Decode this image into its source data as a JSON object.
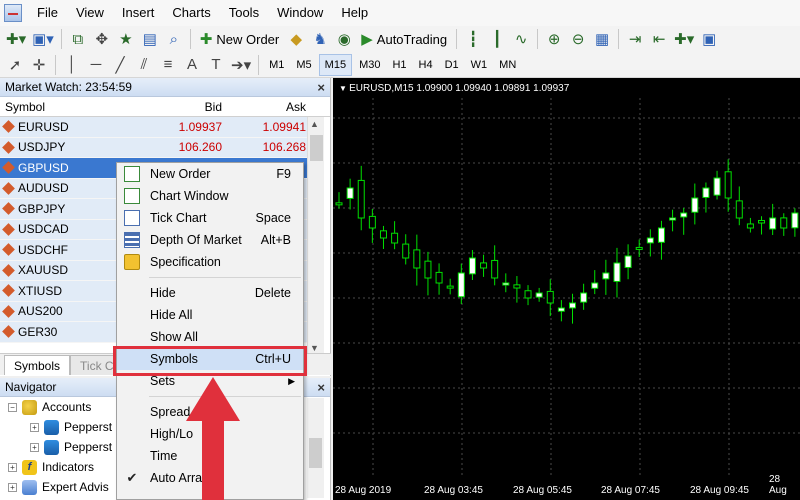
{
  "menubar": {
    "items": [
      "File",
      "View",
      "Insert",
      "Charts",
      "Tools",
      "Window",
      "Help"
    ]
  },
  "toolbar1": {
    "new_order_label": "New Order",
    "autotrading_label": "AutoTrading"
  },
  "toolbar2": {
    "timeframes": [
      "M1",
      "M5",
      "M15",
      "M30",
      "H1",
      "H4",
      "D1",
      "W1",
      "MN"
    ],
    "active_timeframe": "M15"
  },
  "market_watch": {
    "title": "Market Watch: 23:54:59",
    "col_symbol": "Symbol",
    "col_bid": "Bid",
    "col_ask": "Ask",
    "rows": [
      {
        "symbol": "EURUSD",
        "bid": "1.09937",
        "ask": "1.09941"
      },
      {
        "symbol": "USDJPY",
        "bid": "106.260",
        "ask": "106.268"
      },
      {
        "symbol": "GBPUSD",
        "bid": "",
        "ask": ""
      },
      {
        "symbol": "AUDUSD",
        "bid": "",
        "ask": ""
      },
      {
        "symbol": "GBPJPY",
        "bid": "",
        "ask": ""
      },
      {
        "symbol": "USDCAD",
        "bid": "",
        "ask": ""
      },
      {
        "symbol": "USDCHF",
        "bid": "",
        "ask": ""
      },
      {
        "symbol": "XAUUSD",
        "bid": "",
        "ask": ""
      },
      {
        "symbol": "XTIUSD",
        "bid": "",
        "ask": ""
      },
      {
        "symbol": "AUS200",
        "bid": "",
        "ask": ""
      },
      {
        "symbol": "GER30",
        "bid": "",
        "ask": ""
      }
    ],
    "tabs": [
      "Symbols",
      "Tick C"
    ]
  },
  "navigator": {
    "title": "Navigator",
    "items": [
      "Accounts",
      "Pepperst",
      "Pepperst",
      "Indicators",
      "Expert Advis"
    ]
  },
  "chart": {
    "header": "EURUSD,M15  1.09900 1.09940 1.09891 1.09937",
    "x_labels": [
      "28 Aug 2019",
      "28 Aug 03:45",
      "28 Aug 05:45",
      "28 Aug 07:45",
      "28 Aug 09:45",
      "28 Aug"
    ],
    "bull_color": "#ffffff",
    "bear_color": "#000000",
    "wick_color": "#00e000"
  },
  "context_menu": {
    "items": [
      {
        "label": "New Order",
        "shortcut": "F9"
      },
      {
        "label": "Chart Window",
        "shortcut": ""
      },
      {
        "label": "Tick Chart",
        "shortcut": "Space"
      },
      {
        "label": "Depth Of Market",
        "shortcut": "Alt+B"
      },
      {
        "label": "Specification",
        "shortcut": ""
      },
      {
        "label": "Hide",
        "shortcut": "Delete"
      },
      {
        "label": "Hide All",
        "shortcut": ""
      },
      {
        "label": "Show All",
        "shortcut": ""
      },
      {
        "label": "Symbols",
        "shortcut": "Ctrl+U"
      },
      {
        "label": "Sets",
        "shortcut": ""
      },
      {
        "label": "Spread",
        "shortcut": ""
      },
      {
        "label": "High/Lo",
        "shortcut": ""
      },
      {
        "label": "Time",
        "shortcut": ""
      },
      {
        "label": "Auto Arra",
        "shortcut": ""
      }
    ],
    "highlight_color": "#e0303c"
  }
}
